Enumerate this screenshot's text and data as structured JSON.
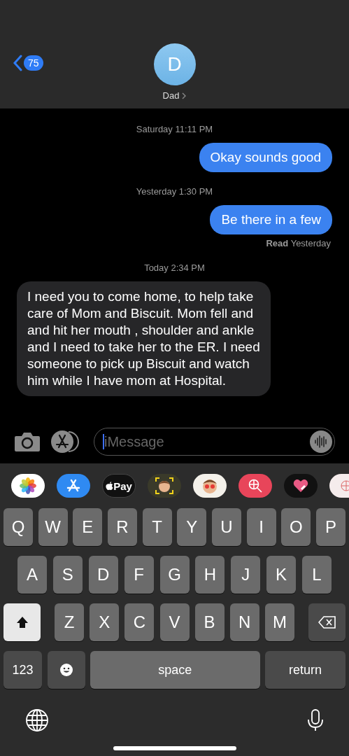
{
  "header": {
    "back_badge": "75",
    "avatar_initial": "D",
    "contact_name": "Dad"
  },
  "messages": [
    {
      "kind": "timestamp",
      "text": "Saturday 11:11 PM"
    },
    {
      "kind": "outgoing",
      "text": "Okay sounds good"
    },
    {
      "kind": "timestamp",
      "text": "Yesterday 1:30 PM"
    },
    {
      "kind": "outgoing",
      "text": "Be there in a few"
    },
    {
      "kind": "receipt",
      "text": "**Read** Yesterday"
    },
    {
      "kind": "timestamp",
      "text": "Today 2:34 PM"
    },
    {
      "kind": "incoming",
      "text": "I need you to come home, to help take care of Mom and Biscuit. Mom fell and and hit her mouth , shoulder and ankle and I need to take her to the ER. I need someone to pick up Biscuit and watch him while I have mom at Hospital."
    }
  ],
  "composer": {
    "placeholder": "iMessage"
  },
  "apps": [
    {
      "kind": "photos"
    },
    {
      "kind": "store"
    },
    {
      "kind": "pay",
      "label": "Pay"
    },
    {
      "kind": "memoji"
    },
    {
      "kind": "stickers"
    },
    {
      "kind": "search"
    },
    {
      "kind": "heart"
    },
    {
      "kind": "partial"
    }
  ],
  "keyboard": [
    [
      {
        "kind": "letter",
        "label": "Q"
      },
      {
        "kind": "letter",
        "label": "W"
      },
      {
        "kind": "letter",
        "label": "E"
      },
      {
        "kind": "letter",
        "label": "R"
      },
      {
        "kind": "letter",
        "label": "T"
      },
      {
        "kind": "letter",
        "label": "Y"
      },
      {
        "kind": "letter",
        "label": "U"
      },
      {
        "kind": "letter",
        "label": "I"
      },
      {
        "kind": "letter",
        "label": "O"
      },
      {
        "kind": "letter",
        "label": "P"
      }
    ],
    [
      {
        "kind": "letter",
        "label": "A"
      },
      {
        "kind": "letter",
        "label": "S"
      },
      {
        "kind": "letter",
        "label": "D"
      },
      {
        "kind": "letter",
        "label": "F"
      },
      {
        "kind": "letter",
        "label": "G"
      },
      {
        "kind": "letter",
        "label": "H"
      },
      {
        "kind": "letter",
        "label": "J"
      },
      {
        "kind": "letter",
        "label": "K"
      },
      {
        "kind": "letter",
        "label": "L"
      }
    ],
    [
      {
        "kind": "shift",
        "on": true
      },
      {
        "kind": "letter",
        "label": "Z"
      },
      {
        "kind": "letter",
        "label": "X"
      },
      {
        "kind": "letter",
        "label": "C"
      },
      {
        "kind": "letter",
        "label": "V"
      },
      {
        "kind": "letter",
        "label": "B"
      },
      {
        "kind": "letter",
        "label": "N"
      },
      {
        "kind": "letter",
        "label": "M"
      },
      {
        "kind": "delete"
      }
    ],
    [
      {
        "kind": "numbers",
        "label": "123"
      },
      {
        "kind": "emoji"
      },
      {
        "kind": "space",
        "label": "space"
      },
      {
        "kind": "return",
        "label": "return"
      }
    ]
  ]
}
